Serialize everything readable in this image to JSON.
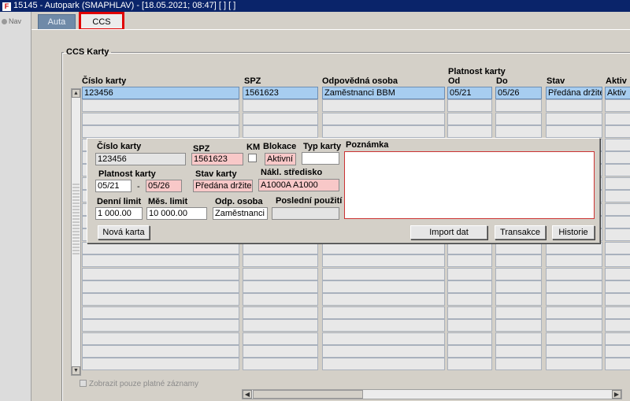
{
  "window": {
    "title": "15145 - Autopark (SMAPHLAV) - [18.05.2021; 08:47] [ ] [ ]"
  },
  "nav": {
    "label": "Nav"
  },
  "tabs": [
    {
      "label": "Auta"
    },
    {
      "label": "CCS karty"
    }
  ],
  "section": {
    "title": "CCS Karty"
  },
  "grid": {
    "header_group": "Platnost karty",
    "columns": [
      "Číslo karty",
      "SPZ",
      "Odpovědná osoba",
      "Od",
      "Do",
      "Stav",
      "Aktiv"
    ],
    "selected_row": [
      "123456",
      "1561623",
      "Zaměstnanci BBM",
      "05/21",
      "05/26",
      "Předána držiteli",
      "Aktiv"
    ]
  },
  "detail": {
    "cislo_karty": {
      "label": "Číslo karty",
      "value": "123456"
    },
    "spz": {
      "label": "SPZ",
      "value": "1561623"
    },
    "km": {
      "label": "KM"
    },
    "blokace": {
      "label": "Blokace",
      "value": "Aktivní"
    },
    "typ_karty": {
      "label": "Typ karty",
      "value": ""
    },
    "poznamka": {
      "label": "Poznámka",
      "value": ""
    },
    "platnost": {
      "label": "Platnost karty",
      "od": "05/21",
      "separator": "-",
      "do": "05/26"
    },
    "stav_karty": {
      "label": "Stav karty",
      "value": "Předána držiteli"
    },
    "nakl_stredisko": {
      "label": "Nákl. středisko",
      "value": "A1000A A1000"
    },
    "denni_limit": {
      "label": "Denní limit",
      "value": "1 000.00"
    },
    "mes_limit": {
      "label": "Měs. limit",
      "value": "10 000.00"
    },
    "odp_osoba": {
      "label": "Odp. osoba",
      "value": "Zaměstnanci BB"
    },
    "posledni_pouziti": {
      "label": "Poslední použití",
      "value": ""
    },
    "buttons": {
      "nova_karta": "Nová karta",
      "import_dat": "Import dat",
      "transakce": "Transakce",
      "historie": "Historie"
    }
  },
  "filter": {
    "label": "Zobrazit pouze platné záznamy",
    "checked": true
  },
  "colors": {
    "titlebar": "#0a246a",
    "selected_row": "#a7cdf0",
    "required_field": "#f8c8c8",
    "active_tab_outline": "#e00000"
  }
}
